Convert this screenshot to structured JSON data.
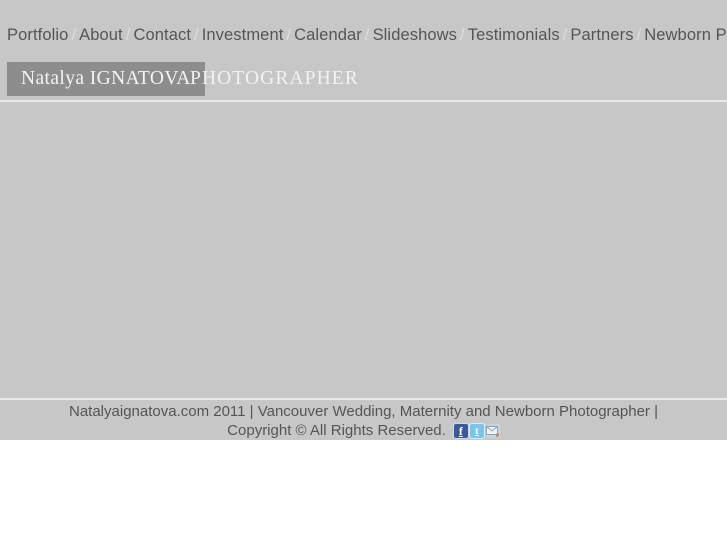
{
  "site": {
    "background_color": "#c7c7c7",
    "text_color": "#555555",
    "divider_color": "#e9e9e9"
  },
  "nav": {
    "separator": "/",
    "items": [
      {
        "label": "Portfolio"
      },
      {
        "label": "About"
      },
      {
        "label": "Contact"
      },
      {
        "label": "Investment"
      },
      {
        "label": "Calendar"
      },
      {
        "label": "Slideshows"
      },
      {
        "label": "Testimonials"
      },
      {
        "label": "Partners"
      },
      {
        "label": "Newborn Props"
      }
    ]
  },
  "logo": {
    "name": "Natalya IGNATOVA",
    "role": "PHOTOGRAPHER",
    "name_background": "#8d8d8d",
    "name_color": "#f4f4f4",
    "role_color": "#f2f2f2"
  },
  "main": {
    "content": "",
    "background_color": "#c8c8c8"
  },
  "footer": {
    "line1": "Natalyaignatova.com 2011 | Vancouver Wedding, Maternity and Newborn Photographer |",
    "line2": "Copyright © All Rights Reserved.",
    "social": [
      {
        "name": "facebook-icon",
        "glyph": "f",
        "color": "#3b5998"
      },
      {
        "name": "twitter-icon",
        "glyph": "t",
        "color": "#78c7e8"
      },
      {
        "name": "email-icon",
        "glyph": "",
        "color": "#c9d4dc"
      }
    ]
  }
}
